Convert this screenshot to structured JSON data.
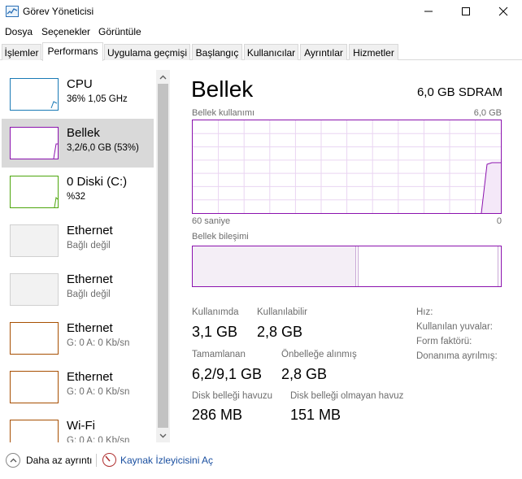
{
  "window": {
    "title": "Görev Yöneticisi"
  },
  "menu": [
    "Dosya",
    "Seçenekler",
    "Görüntüle"
  ],
  "tabs": [
    "İşlemler",
    "Performans",
    "Uygulama geçmişi",
    "Başlangıç",
    "Kullanıcılar",
    "Ayrıntılar",
    "Hizmetler"
  ],
  "active_tab": "Performans",
  "sidebar": [
    {
      "name": "CPU",
      "sub": "36%  1,05 GHz",
      "color": "#1a7ab6"
    },
    {
      "name": "Bellek",
      "sub": "3,2/6,0 GB (53%)",
      "color": "#8b12ae",
      "selected": true
    },
    {
      "name": "0 Diski (C:)",
      "sub": "%32",
      "color": "#4da60c"
    },
    {
      "name": "Ethernet",
      "sub": "Bağlı değil",
      "color": "#d0d0d0"
    },
    {
      "name": "Ethernet",
      "sub": "Bağlı değil",
      "color": "#d0d0d0"
    },
    {
      "name": "Ethernet",
      "sub": "G: 0 A: 0 Kb/sn",
      "color": "#a74f01"
    },
    {
      "name": "Ethernet",
      "sub": "G: 0 A: 0 Kb/sn",
      "color": "#a74f01"
    },
    {
      "name": "Wi-Fi",
      "sub": "G: 0 A: 0 Kb/sn",
      "color": "#a74f01"
    }
  ],
  "main": {
    "title": "Bellek",
    "model": "6,0 GB SDRAM",
    "usage_label": "Bellek kullanımı",
    "usage_max": "6,0 GB",
    "time_left": "60 saniye",
    "time_right": "0",
    "composition_label": "Bellek bileşimi",
    "accent": "#8b12ae"
  },
  "stats": {
    "in_use_label": "Kullanımda",
    "in_use": "3,1 GB",
    "available_label": "Kullanılabilir",
    "available": "2,8 GB",
    "committed_label": "Tamamlanan",
    "committed": "6,2/9,1 GB",
    "cached_label": "Önbelleğe alınmış",
    "cached": "2,8 GB",
    "paged_label": "Disk belleği havuzu",
    "paged": "286 MB",
    "nonpaged_label": "Disk belleği olmayan havuz",
    "nonpaged": "151 MB"
  },
  "details": [
    "Hız:",
    "Kullanılan yuvalar:",
    "Form faktörü:",
    "Donanıma ayrılmış:"
  ],
  "footer": {
    "fewer_details": "Daha az ayrıntı",
    "resource_monitor": "Kaynak İzleyicisini Aç"
  }
}
